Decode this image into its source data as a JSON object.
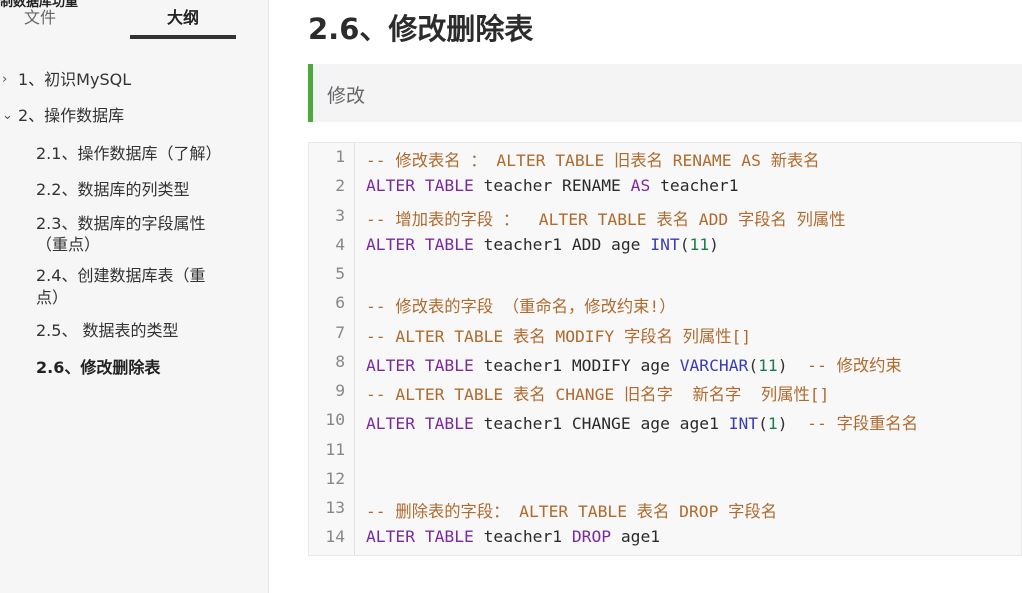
{
  "top_fragment": "制数据库功重",
  "sidebar": {
    "tabs": [
      {
        "label": "文件"
      },
      {
        "label": "大纲"
      }
    ],
    "items": [
      {
        "label": "1、初识MySQL"
      },
      {
        "label": "2、操作数据库"
      },
      {
        "label": "2.1、操作数据库（了解）"
      },
      {
        "label": "2.2、数据库的列类型"
      },
      {
        "label": "2.3、数据库的字段属性"
      },
      {
        "label": "（重点）"
      },
      {
        "label": "2.4、创建数据库表（重"
      },
      {
        "label": "点）"
      },
      {
        "label": "2.5、 数据表的类型"
      },
      {
        "label": "2.6、修改删除表"
      }
    ]
  },
  "main": {
    "title": "2.6、修改删除表",
    "quote": "修改"
  },
  "code": {
    "line_numbers": [
      "1",
      "2",
      "3",
      "4",
      "5",
      "6",
      "7",
      "8",
      "9",
      "10",
      "11",
      "12",
      "13",
      "14"
    ],
    "lines": [
      [
        {
          "t": "cm",
          "v": "-- 修改表名 ： ALTER TABLE 旧表名 RENAME AS 新表名"
        }
      ],
      [
        {
          "t": "kw",
          "v": "ALTER TABLE"
        },
        {
          "t": "id",
          "v": " teacher RENAME "
        },
        {
          "t": "kw",
          "v": "AS"
        },
        {
          "t": "id",
          "v": " teacher1"
        }
      ],
      [
        {
          "t": "cm",
          "v": "-- 增加表的字段 ：  ALTER TABLE 表名 ADD 字段名 列属性"
        }
      ],
      [
        {
          "t": "kw",
          "v": "ALTER TABLE"
        },
        {
          "t": "id",
          "v": " teacher1 ADD age "
        },
        {
          "t": "fn",
          "v": "INT"
        },
        {
          "t": "pn",
          "v": "("
        },
        {
          "t": "num",
          "v": "11"
        },
        {
          "t": "pn",
          "v": ")"
        }
      ],
      [],
      [
        {
          "t": "cm",
          "v": "-- 修改表的字段 （重命名，修改约束!）"
        }
      ],
      [
        {
          "t": "cm",
          "v": "-- ALTER TABLE 表名 MODIFY 字段名 列属性[]"
        }
      ],
      [
        {
          "t": "kw",
          "v": "ALTER TABLE"
        },
        {
          "t": "id",
          "v": " teacher1 MODIFY age "
        },
        {
          "t": "fn",
          "v": "VARCHAR"
        },
        {
          "t": "pn",
          "v": "("
        },
        {
          "t": "num",
          "v": "11"
        },
        {
          "t": "pn",
          "v": ")  "
        },
        {
          "t": "cm",
          "v": "-- 修改约束"
        }
      ],
      [
        {
          "t": "cm",
          "v": "-- ALTER TABLE 表名 CHANGE 旧名字  新名字  列属性[]"
        }
      ],
      [
        {
          "t": "kw",
          "v": "ALTER TABLE"
        },
        {
          "t": "id",
          "v": " teacher1 CHANGE age age1 "
        },
        {
          "t": "fn",
          "v": "INT"
        },
        {
          "t": "pn",
          "v": "("
        },
        {
          "t": "num",
          "v": "1"
        },
        {
          "t": "pn",
          "v": ")  "
        },
        {
          "t": "cm",
          "v": "-- 字段重名名"
        }
      ],
      [],
      [],
      [
        {
          "t": "cm",
          "v": "-- 删除表的字段： ALTER TABLE 表名 DROP 字段名"
        }
      ],
      [
        {
          "t": "kw",
          "v": "ALTER TABLE"
        },
        {
          "t": "id",
          "v": " teacher1 "
        },
        {
          "t": "kw",
          "v": "DROP"
        },
        {
          "t": "id",
          "v": " age1"
        }
      ]
    ]
  },
  "colors": {
    "quote_accent": "#4caa3c",
    "keyword": "#7a2a9e",
    "comment": "#b06a2e",
    "function": "#3b3bb8",
    "number": "#1a7a4a"
  },
  "icons": {
    "collapsed": "chevron-right-icon",
    "expanded": "chevron-down-icon"
  }
}
